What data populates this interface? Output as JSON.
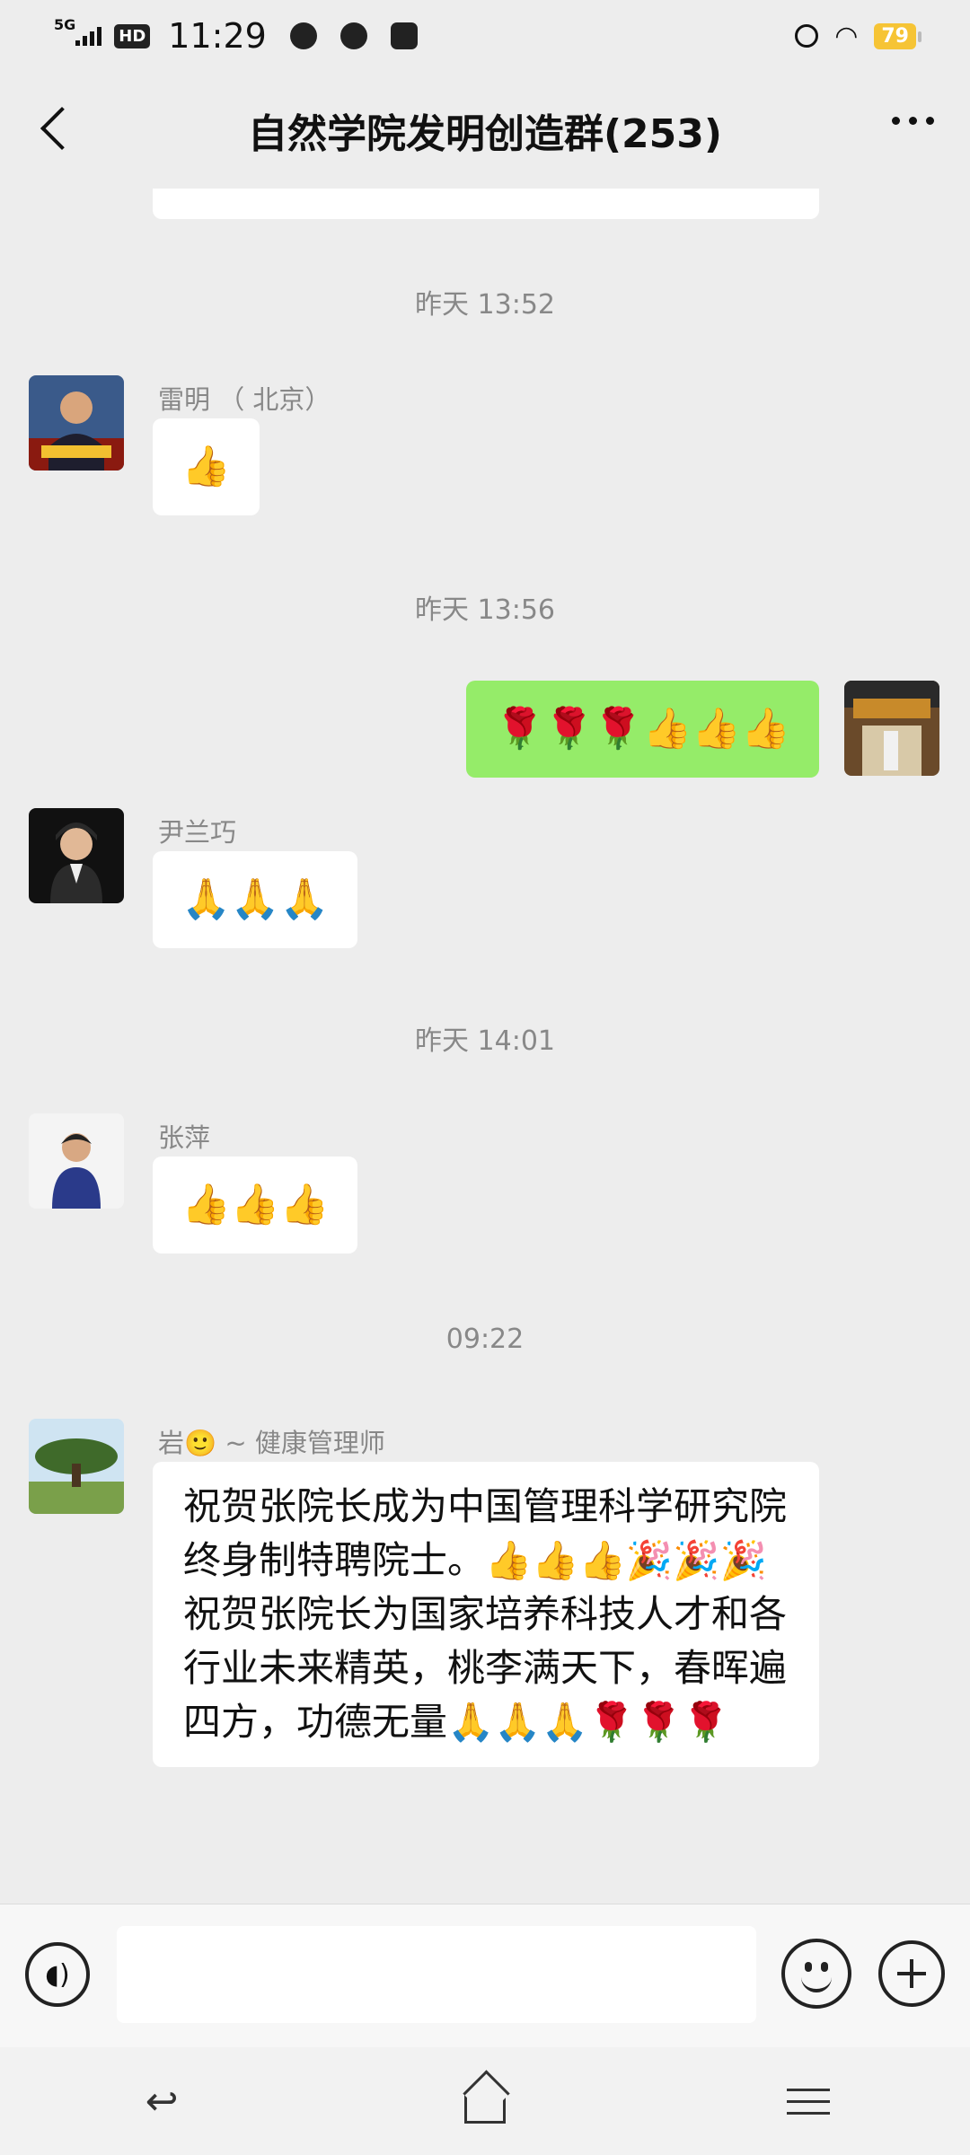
{
  "status_bar": {
    "network": "5G",
    "hd": "HD",
    "time": "11:29",
    "battery": "79"
  },
  "header": {
    "title": "自然学院发明创造群(253)"
  },
  "messages": {
    "ts1": "昨天 13:52",
    "m1": {
      "sender": "雷明 （ 北京）",
      "content": "👍"
    },
    "ts2": "昨天 13:56",
    "m2": {
      "content": "🌹🌹🌹👍👍👍"
    },
    "m3": {
      "sender": "尹兰巧",
      "content": "🙏🙏🙏"
    },
    "ts3": "昨天 14:01",
    "m4": {
      "sender": "张萍",
      "content": "👍👍👍"
    },
    "ts4": "09:22",
    "m5": {
      "sender": "岩🙂 ~ 健康管理师",
      "content": "祝贺张院长成为中国管理科学研究院终身制特聘院士。👍👍👍🎉🎉🎉\n祝贺张院长为国家培养科技人才和各行业未来精英，桃李满天下，春晖遍四方，功德无量🙏🙏🙏🌹🌹🌹"
    }
  },
  "input_bar": {
    "voice_icon": "voice-icon",
    "emoji_icon": "emoji-icon",
    "plus_icon": "plus-icon"
  },
  "system_nav": {
    "back_icon": "↩"
  }
}
